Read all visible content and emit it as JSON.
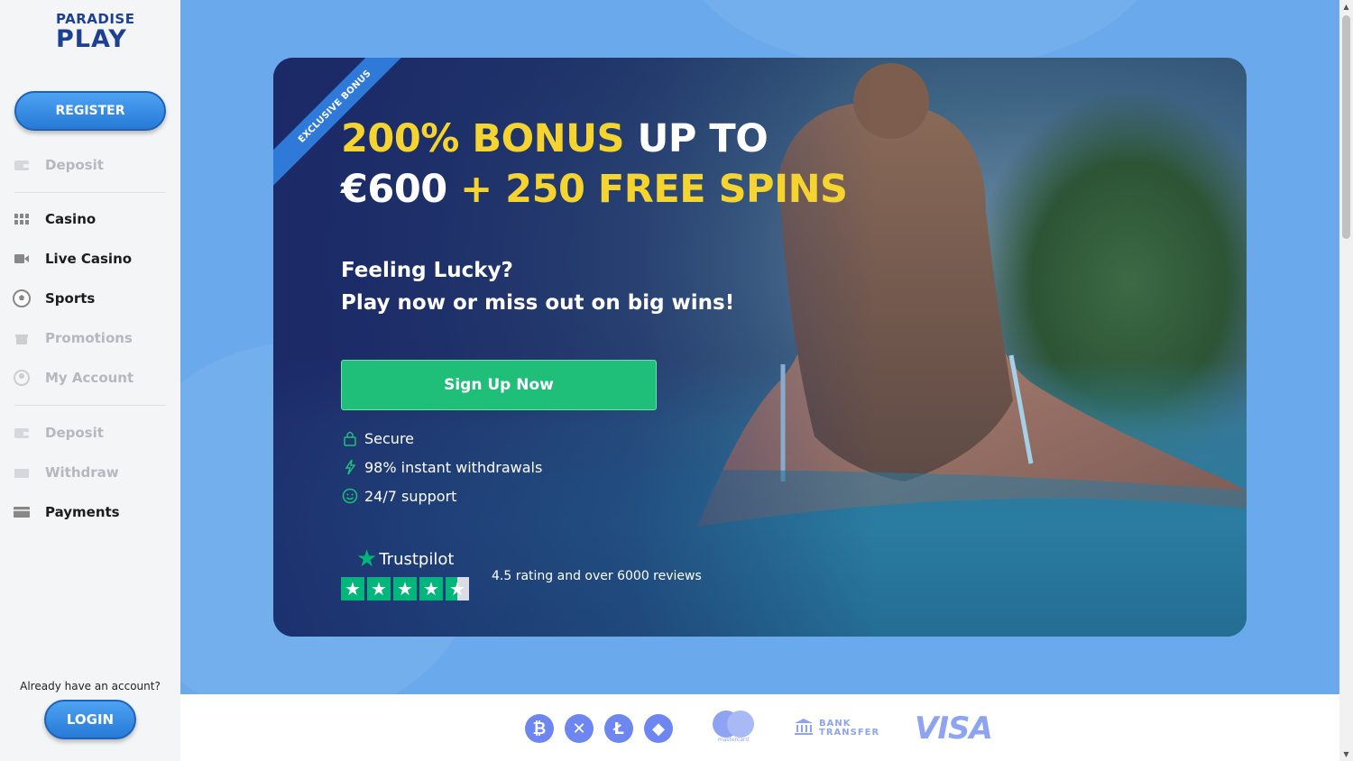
{
  "brand": {
    "line1": "PARADISE",
    "line2": "PLAY"
  },
  "sidebar": {
    "register_label": "REGISTER",
    "items": [
      {
        "label": "Deposit",
        "icon": "wallet-icon",
        "dim": true
      },
      {
        "label": "Casino",
        "icon": "grid-icon",
        "dim": false
      },
      {
        "label": "Live Casino",
        "icon": "camera-icon",
        "dim": false
      },
      {
        "label": "Sports",
        "icon": "soccer-ball-icon",
        "dim": false
      },
      {
        "label": "Promotions",
        "icon": "gift-icon",
        "dim": true
      },
      {
        "label": "My Account",
        "icon": "user-icon",
        "dim": true
      },
      {
        "label": "Deposit",
        "icon": "wallet-icon",
        "dim": true
      },
      {
        "label": "Withdraw",
        "icon": "cash-out-icon",
        "dim": true
      },
      {
        "label": "Payments",
        "icon": "card-icon",
        "dim": false
      }
    ],
    "have_account": "Already have an account?",
    "login_label": "LOGIN"
  },
  "hero": {
    "ribbon": "EXCLUSIVE BONUS",
    "headline": {
      "a": "200% BONUS",
      "b": " UP TO",
      "c": "€600",
      "d": " + 250 FREE SPINS"
    },
    "tagline1": "Feeling Lucky?",
    "tagline2": "Play now or miss out on big wins!",
    "cta": "Sign Up Now",
    "features": [
      {
        "label": "Secure",
        "icon": "lock-icon"
      },
      {
        "label": "98% instant withdrawals",
        "icon": "lightning-icon"
      },
      {
        "label": "24/7 support",
        "icon": "smiley-icon"
      }
    ],
    "trustpilot": {
      "brand": "Trustpilot",
      "rating_text": "4.5 rating and over 6000 reviews",
      "stars": 4.5
    }
  },
  "payments": {
    "coins": [
      {
        "symbol": "₿",
        "icon": "bitcoin-icon"
      },
      {
        "symbol": "✕",
        "icon": "ripple-icon"
      },
      {
        "symbol": "Ł",
        "icon": "litecoin-icon"
      },
      {
        "symbol": "◆",
        "icon": "ethereum-icon"
      }
    ],
    "mastercard_text": "mastercard",
    "bank_line1": "BANK",
    "bank_line2": "TRANSFER",
    "visa": "VISA"
  },
  "colors": {
    "accent_blue": "#2f7ad8",
    "cta_green": "#1fbf7a",
    "headline_yellow": "#f5d430",
    "trustpilot_green": "#00b67a",
    "page_bg": "#6aa9ec"
  }
}
